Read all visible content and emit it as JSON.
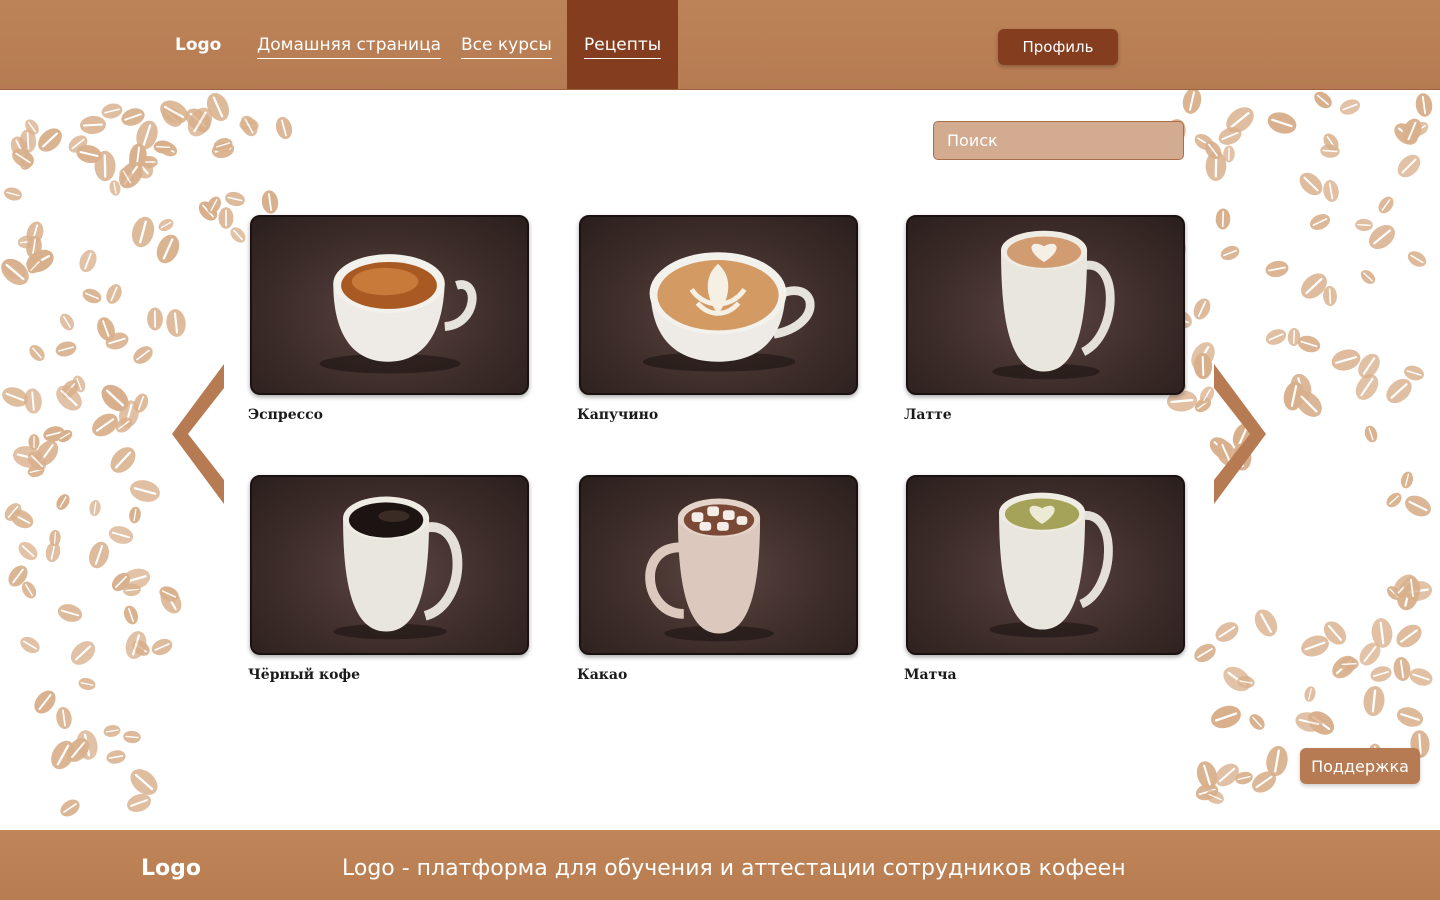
{
  "header": {
    "logo": "Logo",
    "nav": {
      "home": "Домашняя страница",
      "courses": "Все курсы",
      "recipes": "Рецепты"
    },
    "profile_label": "Профиль"
  },
  "search": {
    "placeholder": "Поиск"
  },
  "carousel": {
    "prev_icon": "chevron-left-icon",
    "next_icon": "chevron-right-icon"
  },
  "recipes": [
    {
      "title": "Эспрессо",
      "drink": "espresso"
    },
    {
      "title": "Капучино",
      "drink": "cappuccino"
    },
    {
      "title": "Латте",
      "drink": "latte"
    },
    {
      "title": "Чёрный кофе",
      "drink": "black-coffee"
    },
    {
      "title": "Какао",
      "drink": "cocoa"
    },
    {
      "title": "Матча",
      "drink": "matcha"
    }
  ],
  "support_label": "Поддержка",
  "footer": {
    "logo": "Logo",
    "tagline": "Logo - платформа для обучения и аттестации сотрудников кофеен"
  },
  "colors": {
    "header": "#bd8358",
    "active_nav": "#843d1f",
    "search_bg": "#d3ab91",
    "bean": "#d9b08c",
    "footer": "#b77c50"
  }
}
